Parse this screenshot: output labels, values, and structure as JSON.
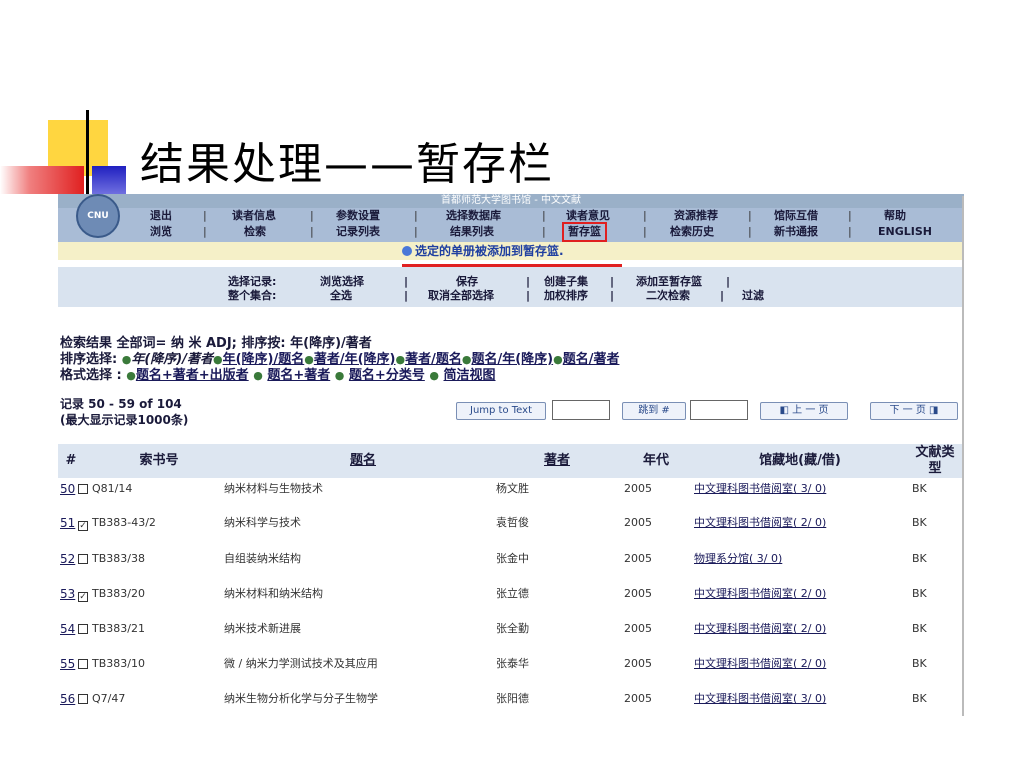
{
  "slide": {
    "title": "结果处理——暂存栏"
  },
  "app": {
    "header_title": "首都师范大学图书馆 - 中文文献",
    "logo_text": "CNU"
  },
  "nav": {
    "row1": [
      "退出",
      "读者信息",
      "参数设置",
      "选择数据库",
      "读者意见",
      "资源推荐",
      "馆际互借",
      "帮助"
    ],
    "row2": [
      "浏览",
      "检索",
      "记录列表",
      "结果列表",
      "暂存篮",
      "检索历史",
      "新书通报",
      "ENGLISH"
    ],
    "highlighted": "暂存篮"
  },
  "notice": "选定的单册被添加到暂存篮.",
  "toolbar": {
    "select_records_label": "选择记录:",
    "whole_set_label": "整个集合:",
    "browse_selected": "浏览选择",
    "select_all": "全选",
    "save": "保存",
    "cancel_all": "取消全部选择",
    "create_subset": "创建子集",
    "weighted_sort": "加权排序",
    "add_to_basket": "添加至暂存篮",
    "secondary_search": "二次检索",
    "filter": "过滤"
  },
  "search": {
    "result_line": "检索结果 全部词= 纳 米 ADJ; 排序按: 年(降序)/著者",
    "sort_label": "排序选择:",
    "sort_current": "年(降序)/著者",
    "sort_options": [
      "年(降序)/题名",
      "著者/年(降序)",
      "著者/题名",
      "题名/年(降序)",
      "题名/著者"
    ],
    "format_label": "格式选择 :",
    "format_options": [
      "题名+著者+出版者",
      "题名+著者",
      "题名+分类号",
      "简洁视图"
    ]
  },
  "records": {
    "range": "记录 50 - 59 of 104",
    "max": "(最大显示记录1000条)",
    "jump_to_text": "Jump to Text",
    "jump_to_num": "跳到 #",
    "prev_page": "上 一 页",
    "next_page": "下 一 页"
  },
  "table": {
    "headers": [
      "#",
      "索书号",
      "题名",
      "著者",
      "年代",
      "馆藏地(藏/借)",
      "文献类型"
    ],
    "rows": [
      {
        "num": "50",
        "checked": false,
        "call": "Q81/14",
        "title": "纳米材料与生物技术",
        "author": "杨文胜",
        "year": "2005",
        "location": "中文理科图书借阅室( 3/ 0)",
        "type": "BK"
      },
      {
        "num": "51",
        "checked": true,
        "call": "TB383-43/2",
        "title": "纳米科学与技术",
        "author": "袁哲俊",
        "year": "2005",
        "location": "中文理科图书借阅室( 2/ 0)",
        "type": "BK"
      },
      {
        "num": "52",
        "checked": false,
        "call": "TB383/38",
        "title": "自组装纳米结构",
        "author": "张金中",
        "year": "2005",
        "location": "物理系分馆( 3/ 0)",
        "type": "BK"
      },
      {
        "num": "53",
        "checked": true,
        "call": "TB383/20",
        "title": "纳米材料和纳米结构",
        "author": "张立德",
        "year": "2005",
        "location": "中文理科图书借阅室( 2/ 0)",
        "type": "BK"
      },
      {
        "num": "54",
        "checked": false,
        "call": "TB383/21",
        "title": "纳米技术新进展",
        "author": "张全勤",
        "year": "2005",
        "location": "中文理科图书借阅室( 2/ 0)",
        "type": "BK"
      },
      {
        "num": "55",
        "checked": false,
        "call": "TB383/10",
        "title": "微 / 纳米力学测试技术及其应用",
        "author": "张泰华",
        "year": "2005",
        "location": "中文理科图书借阅室( 2/ 0)",
        "type": "BK"
      },
      {
        "num": "56",
        "checked": false,
        "call": "Q7/47",
        "title": "纳米生物分析化学与分子生物学",
        "author": "张阳德",
        "year": "2005",
        "location": "中文理科图书借阅室( 3/ 0)",
        "type": "BK"
      }
    ]
  }
}
